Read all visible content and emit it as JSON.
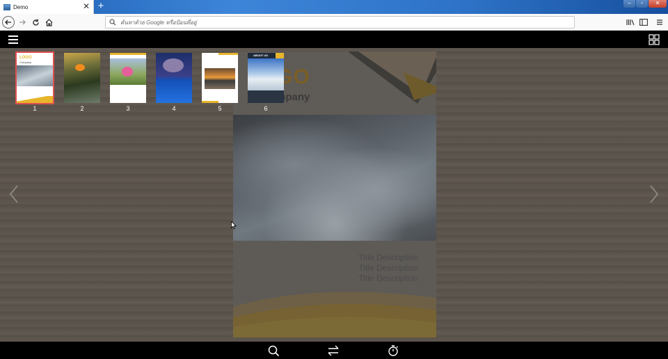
{
  "browser": {
    "tab_title": "Demo",
    "tab_close": "✕",
    "new_tab": "+",
    "url_placeholder": "ค้นหาด้วย Google หรือป้อนที่อยู่"
  },
  "flipbook": {
    "page": {
      "logo": "GO",
      "company": "mpany",
      "descriptions": [
        "Title Description",
        "Title Description",
        "Title Description"
      ]
    },
    "thumbnails": [
      {
        "number": "1",
        "active": true,
        "label_top": "LOGO",
        "label_sub": "Company"
      },
      {
        "number": "2",
        "active": false
      },
      {
        "number": "3",
        "active": false
      },
      {
        "number": "4",
        "active": false
      },
      {
        "number": "5",
        "active": false
      },
      {
        "number": "6",
        "active": false,
        "label_top": "ABOUT US"
      }
    ]
  },
  "colors": {
    "accent_gold": "#e7b52c",
    "active_thumb_border": "#e05050",
    "toolbar_bg": "#000000"
  },
  "icons": {
    "menu": "hamburger-icon",
    "grid": "thumbnail-grid-icon",
    "search": "search-icon",
    "flip": "flip-arrows-icon",
    "autoplay": "timer-icon",
    "prev": "chevron-left-icon",
    "next": "chevron-right-icon"
  }
}
